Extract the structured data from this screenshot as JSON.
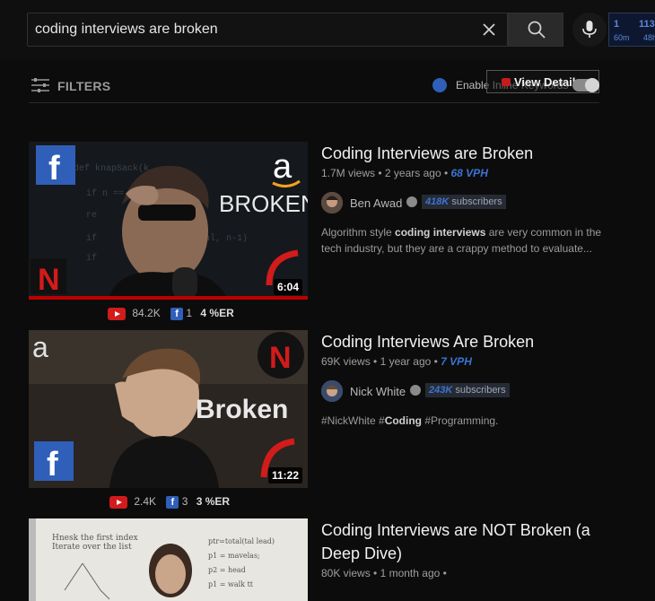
{
  "search": {
    "query": "coding interviews are broken"
  },
  "stats_badge": {
    "v1": "1",
    "v2": "113",
    "l1": "60m",
    "l2": "48h"
  },
  "filters": {
    "label": "FILTERS",
    "enable_label": "Enable Inline Keywords",
    "view_detail": "View Detail"
  },
  "videos": [
    {
      "title": "Coding Interviews are Broken",
      "views": "1.7M views",
      "age": "2 years ago",
      "vph": "68 VPH",
      "channel": "Ben Awad",
      "subs_count": "418K",
      "subs_label": "subscribers",
      "desc_pre": "Algorithm style ",
      "desc_bold": "coding interviews",
      "desc_post": " are very common in the tech industry, but they are a crappy method to evaluate...",
      "duration": "6:04",
      "likes": "84.2K",
      "fb": "1",
      "er": "4 %ER",
      "thumb_text": "BROKEN"
    },
    {
      "title": "Coding Interviews Are Broken",
      "views": "69K views",
      "age": "1 year ago",
      "vph": "7 VPH",
      "channel": "Nick White",
      "subs_count": "243K",
      "subs_label": "subscribers",
      "desc_pre": "#NickWhite #",
      "desc_bold": "Coding",
      "desc_post": " #Programming.",
      "duration": "11:22",
      "likes": "2.4K",
      "fb": "3",
      "er": "3 %ER",
      "thumb_text": "Broken"
    },
    {
      "title": "Coding Interviews are NOT Broken (a Deep Dive)",
      "views": "80K views",
      "age": "1 month ago"
    }
  ],
  "colors": {
    "accent_blue": "#3b74d4",
    "brand_red": "#c41c1c",
    "facebook": "#2f5fb8"
  }
}
